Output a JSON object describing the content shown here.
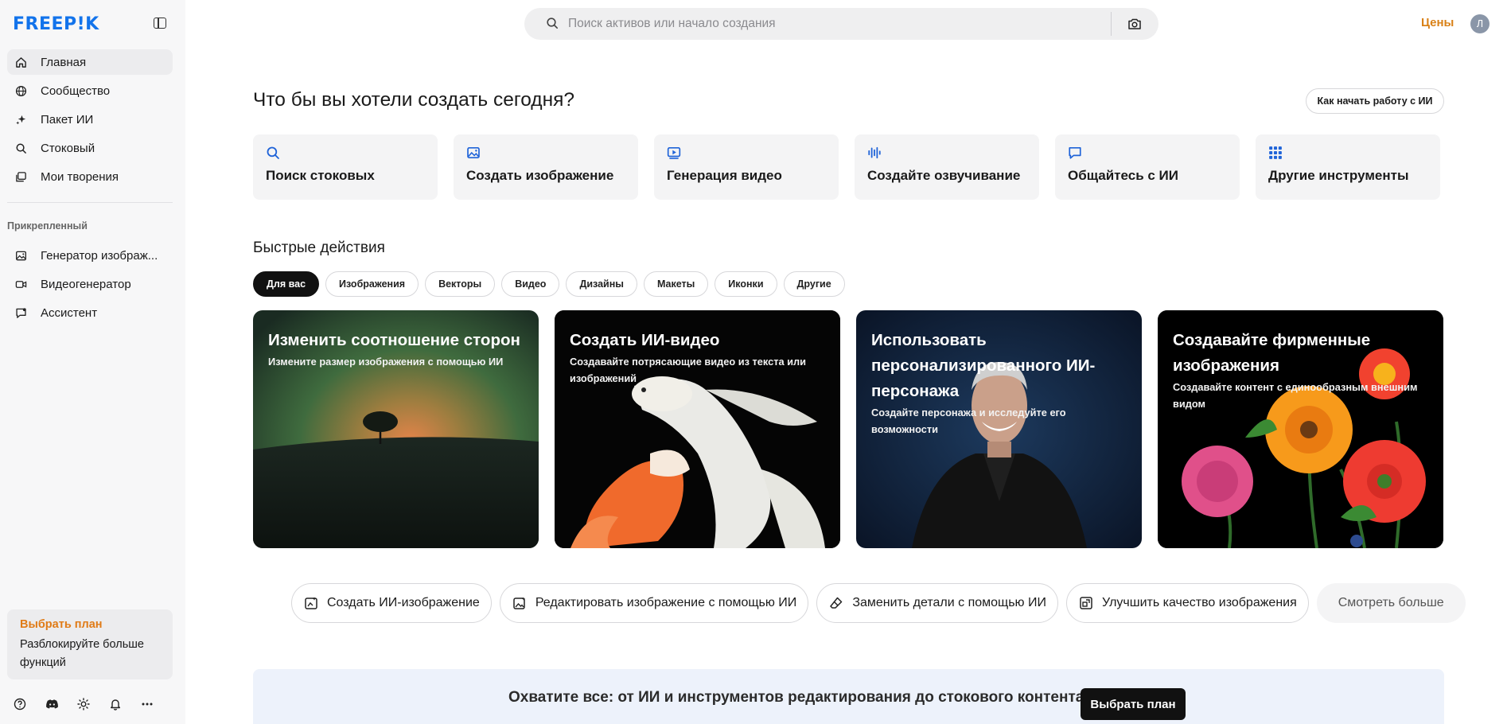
{
  "brand": {
    "logo_text": "FREEP!K",
    "logo_color": "#1273eb"
  },
  "sidebar": {
    "items": [
      {
        "label": "Главная",
        "icon": "home-icon",
        "active": true
      },
      {
        "label": "Сообщество",
        "icon": "globe-icon"
      },
      {
        "label": "Пакет ИИ",
        "icon": "sparkles-icon"
      },
      {
        "label": "Стоковый",
        "icon": "search-icon"
      },
      {
        "label": "Мои творения",
        "icon": "gallery-icon"
      }
    ],
    "pinned_title": "Прикрепленный",
    "pinned": [
      {
        "label": "Генератор изображ...",
        "icon": "image-icon"
      },
      {
        "label": "Видеогенератор",
        "icon": "video-camera-icon"
      },
      {
        "label": "Ассистент",
        "icon": "chat-icon"
      }
    ],
    "plan": {
      "title": "Выбрать план",
      "subtitle": "Разблокируйте больше функций"
    },
    "footer_icons": [
      "help-icon",
      "discord-icon",
      "sun-icon",
      "bell-icon",
      "more-icon"
    ]
  },
  "search": {
    "placeholder": "Поиск активов или начало создания",
    "value": ""
  },
  "header": {
    "prices_label": "Цены",
    "avatar_initial": "Л"
  },
  "main": {
    "title": "Что бы вы хотели создать сегодня?",
    "howto_label": "Как начать работу с ИИ",
    "tools": [
      {
        "label": "Поиск стоковых",
        "icon": "search-icon"
      },
      {
        "label": "Создать изображение",
        "icon": "image-icon"
      },
      {
        "label": "Генерация видео",
        "icon": "video-play-icon"
      },
      {
        "label": "Создайте озвучивание",
        "icon": "audio-wave-icon"
      },
      {
        "label": "Общайтесь с ИИ",
        "icon": "chat-bubble-icon"
      },
      {
        "label": "Другие инструменты",
        "icon": "grid-icon"
      }
    ],
    "quick_title": "Быстрые действия",
    "chips": [
      "Для вас",
      "Изображения",
      "Векторы",
      "Видео",
      "Дизайны",
      "Макеты",
      "Иконки",
      "Другие"
    ],
    "active_chip": "Для вас",
    "cards": [
      {
        "title": "Изменить соотношение сторон",
        "subtitle": "Измените размер изображения с помощью ИИ",
        "art": "sunset-tree-image"
      },
      {
        "title": "Создать ИИ-видео",
        "subtitle": "Создавайте потрясающие видео из текста или изображений",
        "art": "betta-fish-image"
      },
      {
        "title": "Использовать персонализированного ИИ-персонажа",
        "subtitle": "Создайте персонажа и исследуйте его возможности",
        "art": "smiling-man-image"
      },
      {
        "title": "Создавайте фирменные изображения",
        "subtitle": "Создавайте контент с единообразным внешним видом",
        "art": "flowers-image"
      }
    ],
    "actions": [
      {
        "label": "Создать ИИ-изображение",
        "icon": "ai-image-icon"
      },
      {
        "label": "Редактировать изображение с помощью ИИ",
        "icon": "edit-image-icon"
      },
      {
        "label": "Заменить детали с помощью ИИ",
        "icon": "eraser-icon"
      },
      {
        "label": "Улучшить качество изображения",
        "icon": "upscale-icon"
      }
    ],
    "see_more_label": "Смотреть больше"
  },
  "promo": {
    "text": "Охватите все: от ИИ и инструментов редактирования до стокового контента!",
    "button_label": "Выбрать план"
  },
  "colors": {
    "accent_orange": "#d98117",
    "tool_icon_blue": "#1f63d8",
    "promo_bg": "#edf2fb"
  }
}
